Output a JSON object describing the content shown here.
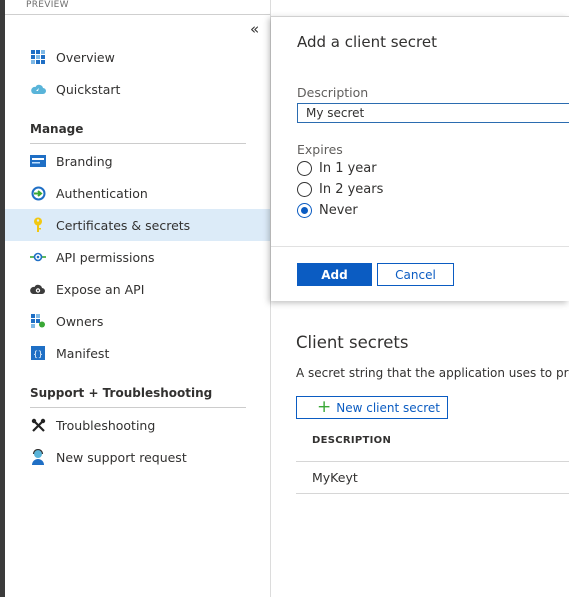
{
  "header": {
    "preview_label": "PREVIEW",
    "collapse_glyph": "«"
  },
  "sidebar": {
    "items_top": [
      {
        "label": "Overview",
        "icon": "overview-grid-icon"
      },
      {
        "label": "Quickstart",
        "icon": "cloud-icon"
      }
    ],
    "section_manage": "Manage",
    "items_manage": [
      {
        "label": "Branding",
        "icon": "branding-icon"
      },
      {
        "label": "Authentication",
        "icon": "authentication-icon"
      },
      {
        "label": "Certificates & secrets",
        "icon": "key-icon",
        "active": true
      },
      {
        "label": "API permissions",
        "icon": "api-permissions-icon"
      },
      {
        "label": "Expose an API",
        "icon": "cloud-gear-icon"
      },
      {
        "label": "Owners",
        "icon": "owners-grid-icon"
      },
      {
        "label": "Manifest",
        "icon": "manifest-icon"
      }
    ],
    "section_support": "Support + Troubleshooting",
    "items_support": [
      {
        "label": "Troubleshooting",
        "icon": "tools-icon"
      },
      {
        "label": "New support request",
        "icon": "support-person-icon"
      }
    ]
  },
  "panel": {
    "title": "Add a client secret",
    "description_label": "Description",
    "description_value": "My secret",
    "expires_label": "Expires",
    "options": [
      "In 1 year",
      "In 2 years",
      "Never"
    ],
    "selected_option": "Never",
    "add_label": "Add",
    "cancel_label": "Cancel"
  },
  "client_secrets": {
    "title": "Client secrets",
    "description": "A secret string that the application uses to prove",
    "new_button_label": "New client secret",
    "table_header": "DESCRIPTION",
    "rows": [
      "MyKeyt"
    ]
  },
  "colors": {
    "accent": "#0b5cc2",
    "active_bg": "#dcebf8",
    "plus": "#3aa836"
  }
}
